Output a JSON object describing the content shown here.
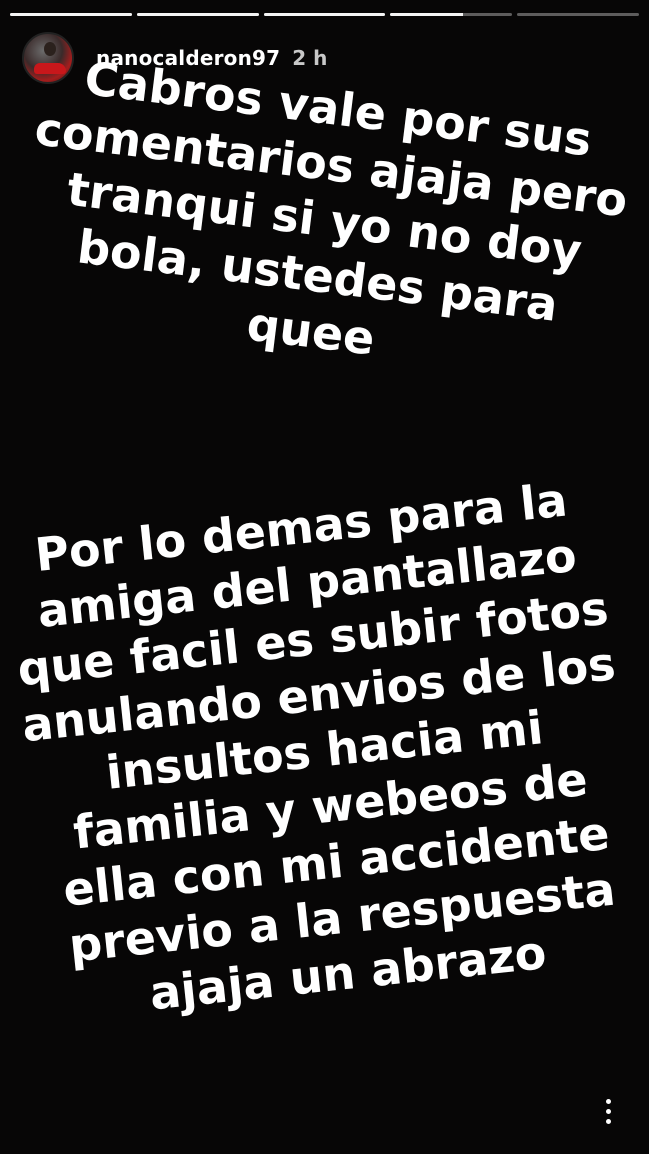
{
  "story": {
    "segments": [
      {
        "progress": 1.0
      },
      {
        "progress": 1.0
      },
      {
        "progress": 1.0
      },
      {
        "progress": 0.6
      },
      {
        "progress": 0.0
      }
    ],
    "user": {
      "username": "nanocalderon97",
      "time": "2 h"
    },
    "text_block_1": [
      "Cabros vale por sus",
      "comentarios ajaja pero",
      "tranqui si yo no doy",
      "bola, ustedes para",
      "quee"
    ],
    "text_block_2": [
      "Por lo demas para la",
      "amiga del pantallazo",
      "que facil es subir fotos",
      "anulando envios de los",
      "insultos hacia mi",
      "familia y webeos de",
      "ella con mi accidente",
      "previo a la respuesta",
      "ajaja un abrazo"
    ],
    "more_icon": "more-vertical-icon"
  }
}
